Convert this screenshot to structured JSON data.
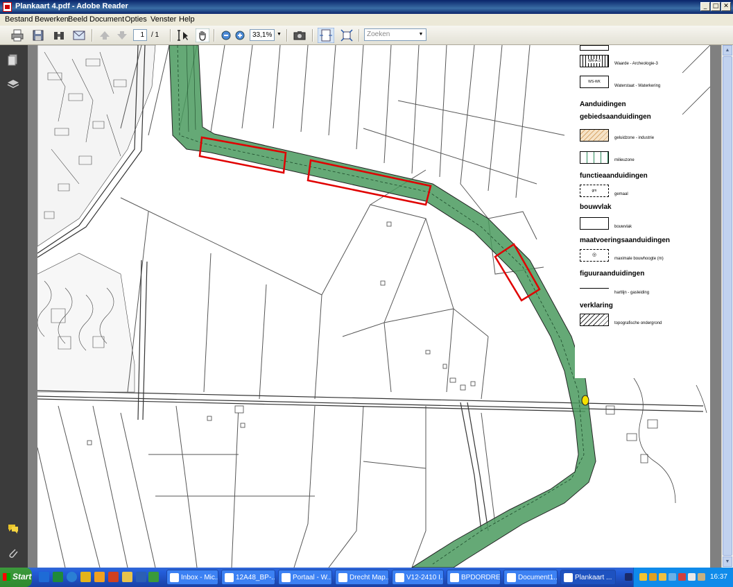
{
  "window": {
    "title": "Plankaart 4.pdf - Adobe Reader"
  },
  "menu": [
    "Bestand",
    "Bewerken",
    "Beeld",
    "Document",
    "Opties",
    "Venster",
    "Help"
  ],
  "toolbar": {
    "page_current": "1",
    "page_total": "/ 1",
    "zoom": "33,1%",
    "search_placeholder": "Zoeken",
    "icons": [
      "print-icon",
      "save-icon",
      "binoculars-icon",
      "email-icon",
      "prev-page-icon",
      "next-page-icon",
      "select-text-icon",
      "hand-icon",
      "zoom-out-icon",
      "zoom-in-icon",
      "snapshot-icon",
      "fit-width-icon",
      "full-screen-icon"
    ]
  },
  "legend": {
    "headings": {
      "aanduidingen": "Aanduidingen",
      "gebied": "gebiedsaanduidingen",
      "functie": "functieaanduidingen",
      "bouwvlak": "bouwvlak",
      "maatvoering": "maatvoeringsaanduidingen",
      "figuur": "figuuraanduidingen",
      "verklaring": "verklaring"
    },
    "items": {
      "archeo_code": "WR-A-3",
      "archeo": "Waarde - Archeologie-3",
      "water_code": "WS-WK",
      "water": "Waterstaat - Waterkering",
      "geluid": "geluidzone - industrie",
      "milieu": "milieuzone",
      "gemaal_code": "gm",
      "gemaal": "gemaal",
      "bouwvlak": "bouwvlak",
      "bouwhoogte": "maximale bouwhoogte (m)",
      "hartlijn": "hartlijn - gasleiding",
      "topo": "topografische ondergrond"
    },
    "colors": {
      "dike_green": "#4a9a5e",
      "highlight_red": "#e00000",
      "geluid_fill": "#f6e3c7"
    }
  },
  "taskbar": {
    "start": "Start",
    "tasks": [
      "Inbox - Mic...",
      "12A48_BP-...",
      "Portaal - W...",
      "Drecht Map...",
      "V12-2410 I...",
      "BPDORDRE...",
      "Document1...",
      "Plankaart ..."
    ],
    "clock": "16:37"
  }
}
